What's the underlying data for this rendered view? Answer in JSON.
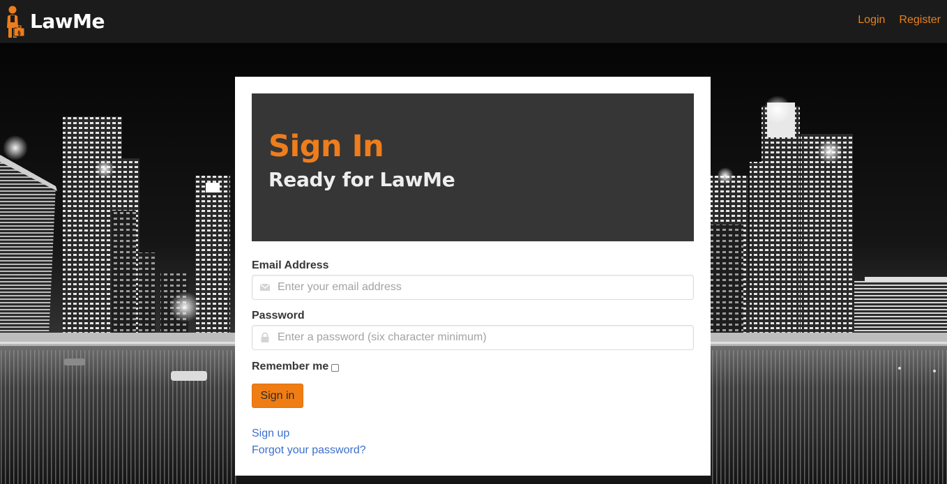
{
  "brand": {
    "name": "LawMe",
    "logo_icon": "lawyer-with-briefcase-icon",
    "accent": "#ee7d1c"
  },
  "nav": {
    "login": "Login",
    "register": "Register"
  },
  "hero": {
    "title": "Sign In",
    "subtitle": "Ready for LawMe"
  },
  "form": {
    "email_label": "Email Address",
    "email_icon": "envelope-icon",
    "email_placeholder": "Enter your email address",
    "email_value": "",
    "password_label": "Password",
    "password_icon": "lock-icon",
    "password_placeholder": "Enter a password (six character minimum)",
    "password_value": "",
    "remember_label": "Remember me",
    "remember_checked": false,
    "submit_label": "Sign in"
  },
  "links": {
    "signup": "Sign up",
    "forgot": "Forgot your password?"
  },
  "colors": {
    "link": "#3b6fcc",
    "button": "#ef7d14",
    "hero_bg": "#363636",
    "navbar_bg": "#1b1b1b"
  },
  "background": {
    "image": "night-city-skyline-waterfront-photo"
  }
}
